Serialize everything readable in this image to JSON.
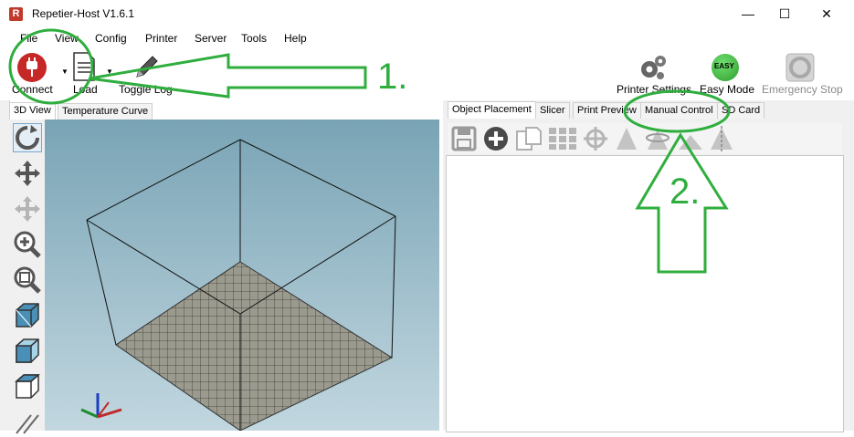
{
  "window": {
    "title": "Repetier-Host V1.6.1",
    "icon_letter": "R",
    "controls": {
      "minimize": "—",
      "maximize": "☐",
      "close": "✕"
    }
  },
  "menu": [
    "File",
    "View",
    "Config",
    "Printer",
    "Server",
    "Tools",
    "Help"
  ],
  "toolbar": {
    "connect_label": "Connect",
    "load_label": "Load",
    "toggle_log_label": "Toggle Log",
    "printer_settings_label": "Printer Settings",
    "easy_mode_label": "Easy Mode",
    "easy_badge": "EASY",
    "emergency_stop_label": "Emergency Stop"
  },
  "left_tabs": [
    "3D View",
    "Temperature Curve"
  ],
  "right_tabs": [
    "Object Placement",
    "Slicer",
    "Print Preview",
    "Manual Control",
    "SD Card"
  ],
  "annotations": {
    "first": "1.",
    "second": "2."
  },
  "colors": {
    "annotation_green": "#2fae3e",
    "connect_red": "#c62828",
    "easy_green": "#2e9d2e",
    "viewport_top": "#79a4b5",
    "viewport_bottom": "#c2d7e0",
    "plate": "#9a9a8e"
  }
}
